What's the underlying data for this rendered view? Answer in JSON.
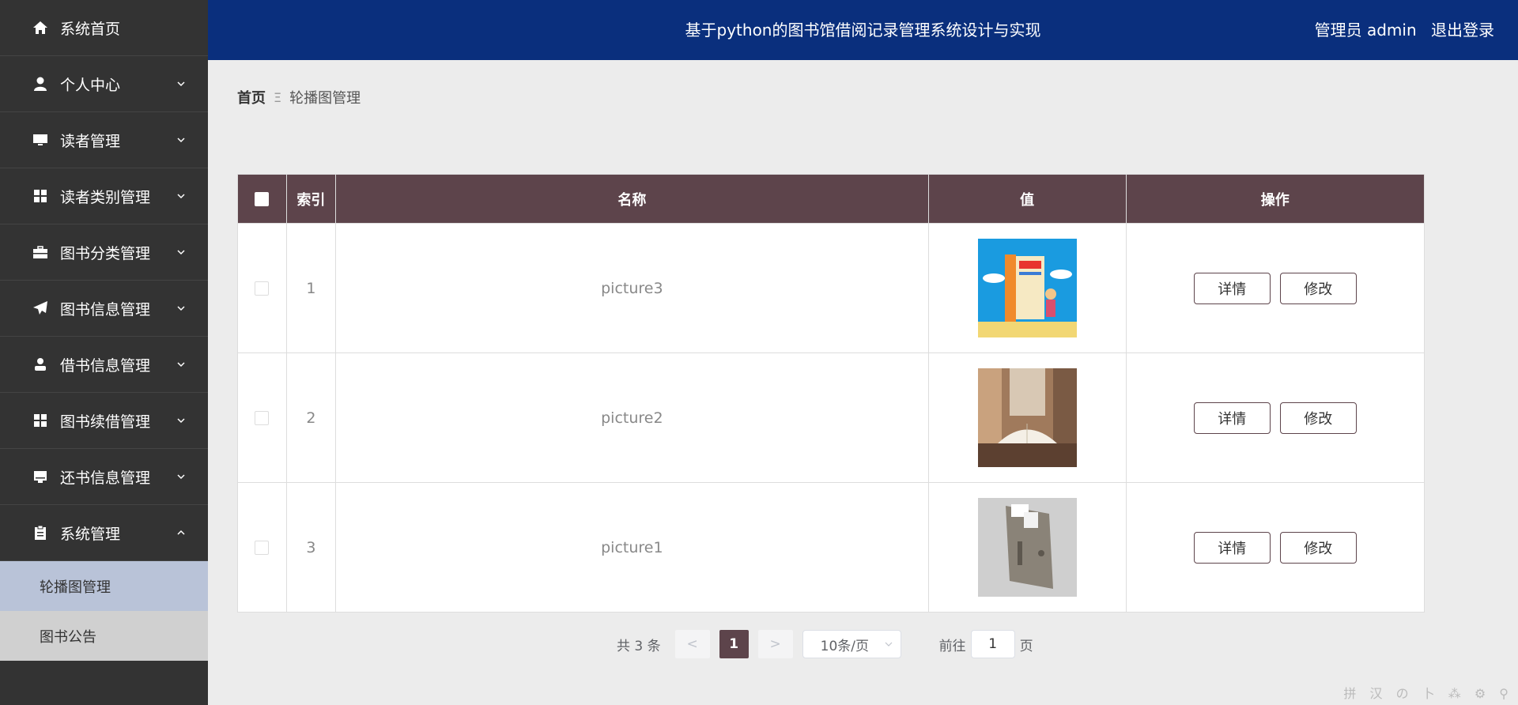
{
  "header": {
    "title": "基于python的图书馆借阅记录管理系统设计与实现",
    "user_label": "管理员 admin",
    "logout": "退出登录"
  },
  "sidebar": {
    "items": [
      {
        "label": "系统首页",
        "icon": "home-icon"
      },
      {
        "label": "个人中心",
        "icon": "user-icon"
      },
      {
        "label": "读者管理",
        "icon": "monitor-icon"
      },
      {
        "label": "读者类别管理",
        "icon": "grid-icon"
      },
      {
        "label": "图书分类管理",
        "icon": "briefcase-icon"
      },
      {
        "label": "图书信息管理",
        "icon": "paper-plane-icon"
      },
      {
        "label": "借书信息管理",
        "icon": "person-icon"
      },
      {
        "label": "图书续借管理",
        "icon": "grid-icon"
      },
      {
        "label": "还书信息管理",
        "icon": "inbox-icon"
      },
      {
        "label": "系统管理",
        "icon": "clipboard-icon"
      }
    ],
    "submenu": [
      {
        "label": "轮播图管理"
      },
      {
        "label": "图书公告"
      }
    ]
  },
  "breadcrumb": {
    "home": "首页",
    "separator": "Ξ",
    "current": "轮播图管理"
  },
  "table": {
    "headers": {
      "index": "索引",
      "name": "名称",
      "value": "值",
      "ops": "操作"
    },
    "rows": [
      {
        "index": "1",
        "name": "picture3"
      },
      {
        "index": "2",
        "name": "picture2"
      },
      {
        "index": "3",
        "name": "picture1"
      }
    ],
    "detail_label": "详情",
    "edit_label": "修改"
  },
  "pagination": {
    "total": "共 3 条",
    "prev": "<",
    "current_page": "1",
    "next": ">",
    "page_size": "10条/页",
    "goto_label": "前往",
    "goto_value": "1",
    "page_suffix": "页"
  },
  "watermark": "拼 汉 の 卜 ⁂ ⚙ ⚲",
  "colors": {
    "header_bg": "#0a2f7d",
    "sidebar_bg": "#333333",
    "table_header_bg": "#5d444b",
    "submenu_active_bg": "#b9c3d8"
  }
}
